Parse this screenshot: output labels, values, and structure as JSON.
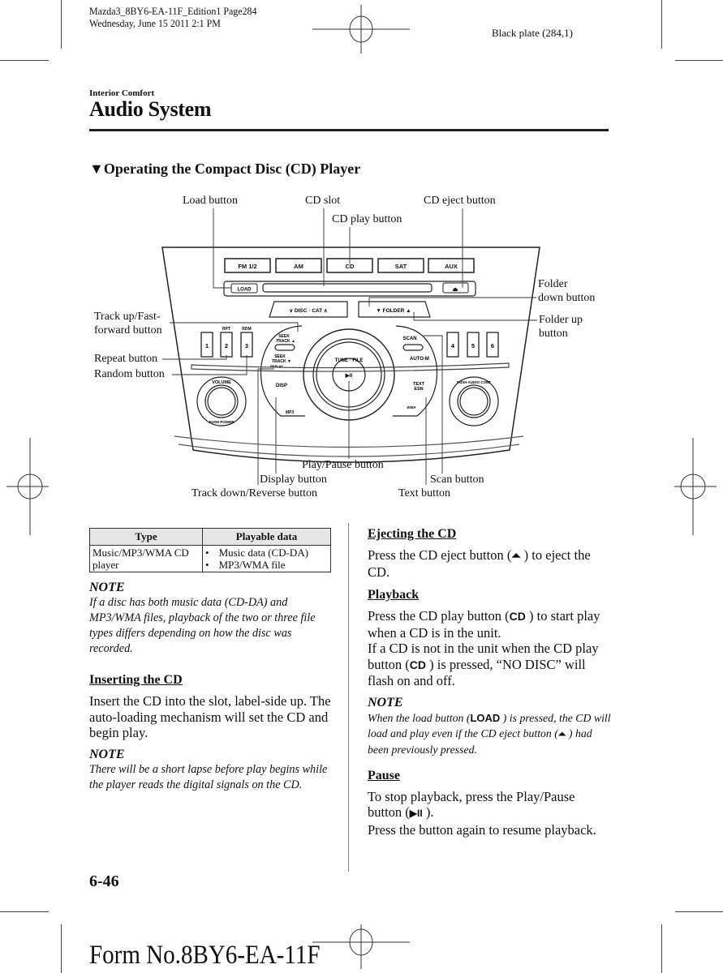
{
  "print_header": {
    "file_line": "Mazda3_8BY6-EA-11F_Edition1 Page284",
    "date_line": "Wednesday, June 15 2011 2:1 PM",
    "plate": "Black plate (284,1)"
  },
  "section": "Interior Comfort",
  "title": "Audio System",
  "subsection": {
    "marker_icon": "triangle-down-icon",
    "marker": "▼",
    "title": "Operating the Compact Disc (CD) Player"
  },
  "diagram": {
    "callouts": {
      "load": "Load button",
      "cd_slot": "CD slot",
      "cd_eject": "CD eject button",
      "cd_play": "CD play button",
      "folder_down_1": "Folder",
      "folder_down_2": "down button",
      "folder_up_1": "Folder up",
      "folder_up_2": "button",
      "track_up_1": "Track up/Fast-",
      "track_up_2": "forward button",
      "repeat": "Repeat button",
      "random": "Random button",
      "play_pause": "Play/Pause button",
      "display": "Display button",
      "track_down": "Track down/Reverse button",
      "scan": "Scan button",
      "text": "Text button"
    },
    "panel": {
      "source_buttons": [
        "FM 1/2",
        "AM",
        "CD",
        "SAT",
        "AUX"
      ],
      "load": "LOAD",
      "eject": "⏏",
      "disc_cat": "∨  DISC · CAT  ∧",
      "folder": "▼     FOLDER     ▲",
      "presets_left": [
        "1",
        "2",
        "3"
      ],
      "presets_right": [
        "4",
        "5",
        "6"
      ],
      "rpt": "RPT",
      "rdm": "RDM",
      "seek_up": [
        "SEEK",
        "TRACK ▲"
      ],
      "seek_down": [
        "SEEK",
        "TRACK ▼",
        "REPLAY"
      ],
      "disp": "DISP",
      "mp3": "MP3",
      "scan": "SCAN",
      "auto_m": "AUTO-M",
      "text_esn": [
        "TEXT",
        "ESN"
      ],
      "wma": "WMA",
      "tune_file": "TUNE · FILE",
      "play_pause": "▶II",
      "volume": "VOLUME",
      "power": "PUSH POWER",
      "audio_cont": "PUSH AUDIO CONT"
    }
  },
  "table": {
    "headers": [
      "Type",
      "Playable data"
    ],
    "rows": [
      {
        "type": "Music/MP3/WMA CD player",
        "data": [
          "Music data (CD-DA)",
          "MP3/WMA file"
        ]
      }
    ]
  },
  "left_column": {
    "note1_head": "NOTE",
    "note1_text": "If a disc has both music data (CD-DA) and MP3/WMA files, playback of the two or three file types differs depending on how the disc was recorded.",
    "inserting_head": "Inserting the CD",
    "inserting_text": "Insert the CD into the slot, label-side up. The auto-loading mechanism will set the CD and begin play.",
    "note2_head": "NOTE",
    "note2_text": "There will be a short lapse before play begins while the player reads the digital signals on the CD."
  },
  "right_column": {
    "ejecting_head": "Ejecting the CD",
    "ejecting_pre": "Press the CD eject button (",
    "ejecting_icon": "⏶",
    "ejecting_post": " ) to eject the CD.",
    "playback_head": "Playback",
    "playback_p1_pre": "Press the CD play button (",
    "playback_icon": "CD",
    "playback_p1_post": " ) to start play when a CD is in the unit.",
    "playback_p2_pre": "If a CD is not in the unit when the CD play button (",
    "playback_p2_post": " ) is pressed, “NO DISC” will flash on and off.",
    "note_head": "NOTE",
    "note_pre": "When the load button (",
    "note_load_icon": "LOAD",
    "note_mid": " ) is pressed, the CD will load and play even if the CD eject button (",
    "note_eject_icon": "⏶",
    "note_post": " ) had been previously pressed.",
    "pause_head": "Pause",
    "pause_p1_pre": "To stop playback, press the Play/Pause button (",
    "pause_icon": "▶II",
    "pause_p1_post": " ).",
    "pause_p2": "Press the button again to resume playback."
  },
  "page_number": "6-46",
  "form_number": "Form No.8BY6-EA-11F"
}
